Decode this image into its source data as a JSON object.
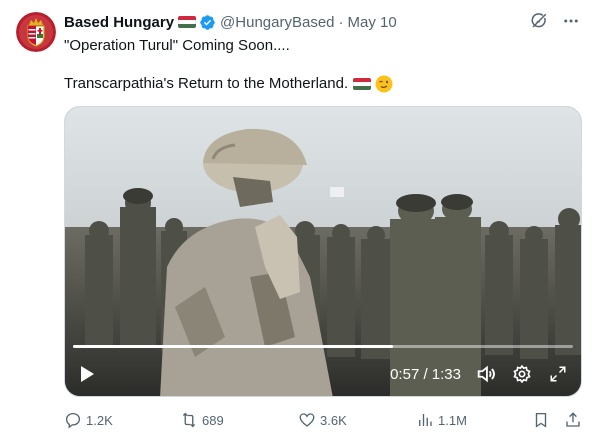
{
  "tweet": {
    "author_name": "Based Hungary",
    "handle": "@HungaryBased",
    "separator": "·",
    "date": "May 10",
    "line1": "\"Operation Turul\" Coming Soon....",
    "line2": "Transcarpathia's Return to the Motherland."
  },
  "video": {
    "progress": 0.64,
    "time_display": "0:57 / 1:33"
  },
  "actions": {
    "replies": "1.2K",
    "reposts": "689",
    "likes": "3.6K",
    "views": "1.1M"
  },
  "colors": {
    "text": "#0f1419",
    "secondary": "#536471",
    "verified": "#1d9bf0",
    "flag_red": "#cd2a3e",
    "flag_green": "#436f4d"
  },
  "icons": [
    "avatar-coat-of-arms",
    "hungary-flag-icon",
    "verified-badge-icon",
    "grok-icon",
    "more-icon",
    "winking-face-icon",
    "play-icon",
    "volume-icon",
    "settings-icon",
    "fullscreen-icon",
    "reply-icon",
    "repost-icon",
    "like-icon",
    "views-icon",
    "bookmark-icon",
    "share-icon"
  ]
}
